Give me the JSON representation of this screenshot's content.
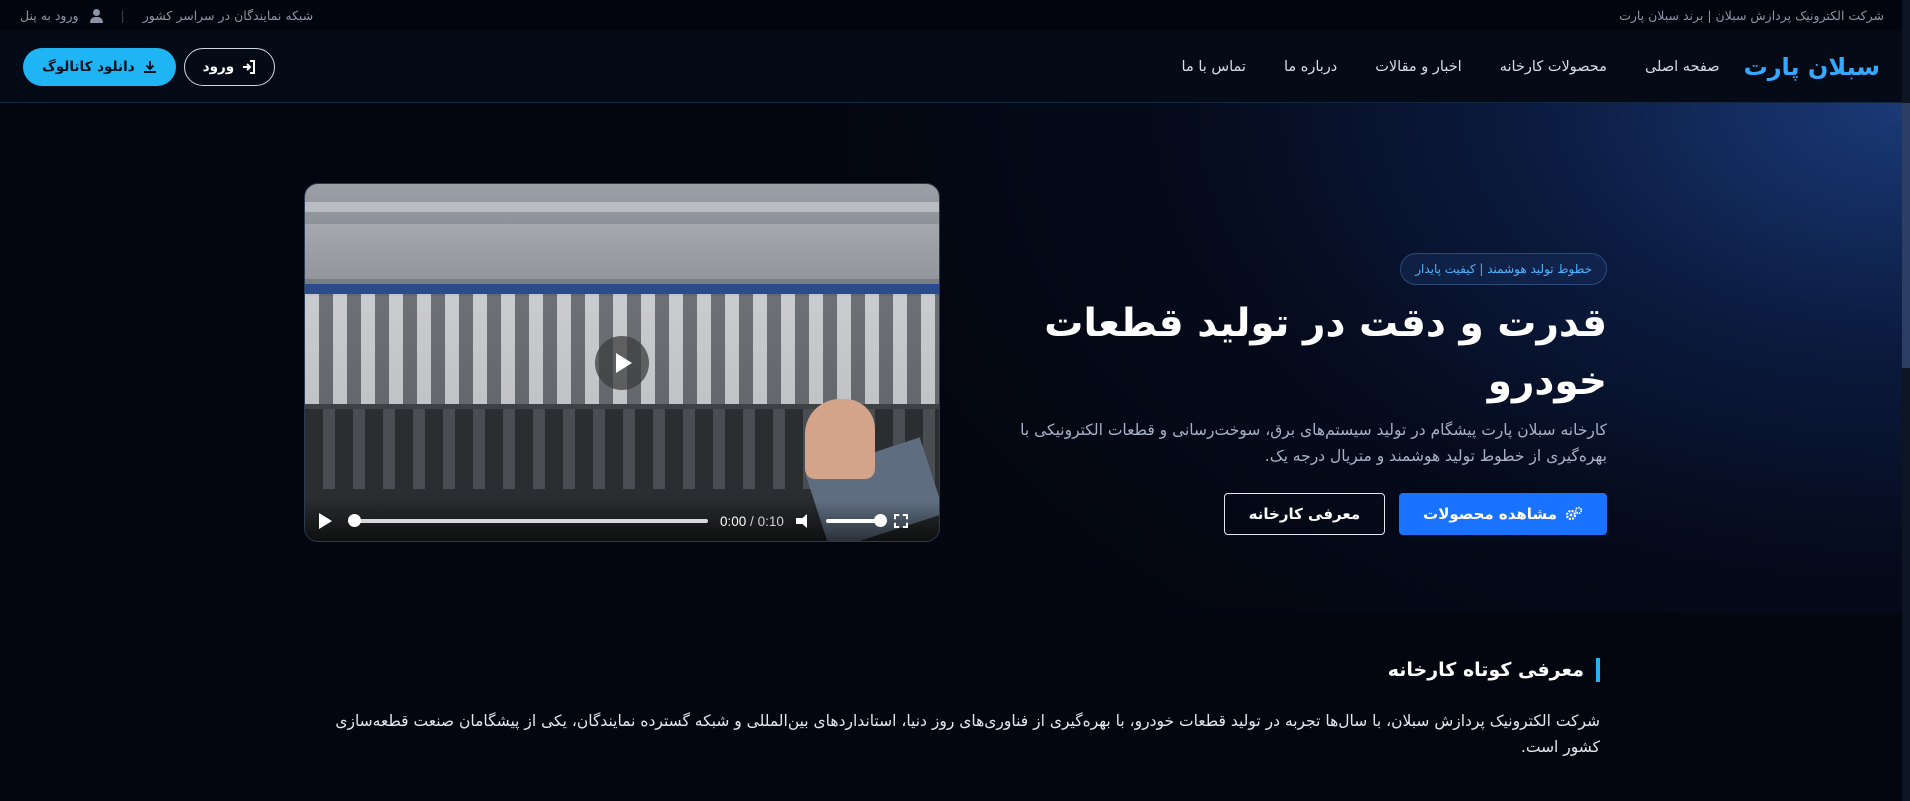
{
  "topbar": {
    "company": "شرکت الکترونیک پردازش سبلان | برند سبلان پارت",
    "network": "شبکه نمایندگان در سراسر کشور",
    "panel_login": "ورود به پنل"
  },
  "header": {
    "logo": "سبلان پارت",
    "nav": [
      "صفحه اصلی",
      "محصولات کارخانه",
      "اخبار و مقالات",
      "درباره ما",
      "تماس با ما"
    ],
    "login_label": "ورود",
    "catalog_label": "دانلود کاتالوگ"
  },
  "hero": {
    "badge": "خطوط تولید هوشمند | کیفیت پایدار",
    "title": "قدرت و دقت در تولید قطعات خودرو",
    "description": "کارخانه سبلان پارت پیشگام در تولید سیستم‌های برق، سوخت‌رسانی و قطعات الکترونیکی با بهره‌گیری از خطوط تولید هوشمند و متریال درجه یک.",
    "products_button": "مشاهده محصولات",
    "factory_button": "معرفی کارخانه"
  },
  "video": {
    "current_time": "0:00",
    "duration": "0:10"
  },
  "intro": {
    "title": "معرفی کوتاه کارخانه",
    "text": "شرکت الکترونیک پردازش سبلان، با سال‌ها تجربه در تولید قطعات خودرو، با بهره‌گیری از فناوری‌های روز دنیا، استانداردهای بین‌المللی و شبکه گسترده نمایندگان، یکی از پیشگامان صنعت قطعه‌سازی کشور است."
  },
  "colors": {
    "accent_cyan": "#1fb5f5",
    "primary_blue": "#1a73ff",
    "logo_blue": "#36a9ff"
  }
}
